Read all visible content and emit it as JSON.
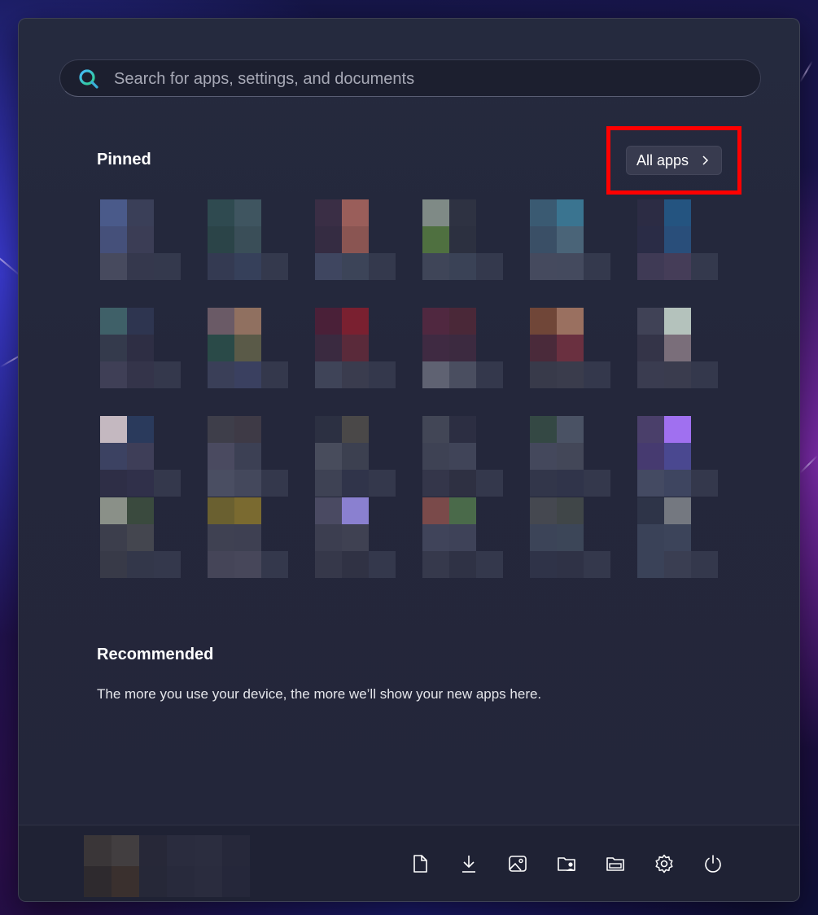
{
  "search": {
    "placeholder": "Search for apps, settings, and documents"
  },
  "pinned": {
    "title": "Pinned",
    "all_apps_label": "All apps"
  },
  "recommended": {
    "title": "Recommended",
    "empty_text": "The more you use your device, the more we’ll show your new apps here."
  },
  "footer": {
    "icons": [
      "document-icon",
      "downloads-icon",
      "pictures-icon",
      "user-folder-icon",
      "file-explorer-icon",
      "settings-gear-icon",
      "power-icon"
    ]
  },
  "colors": {
    "highlight": "#ff0000",
    "accent": "#46b9ff"
  }
}
